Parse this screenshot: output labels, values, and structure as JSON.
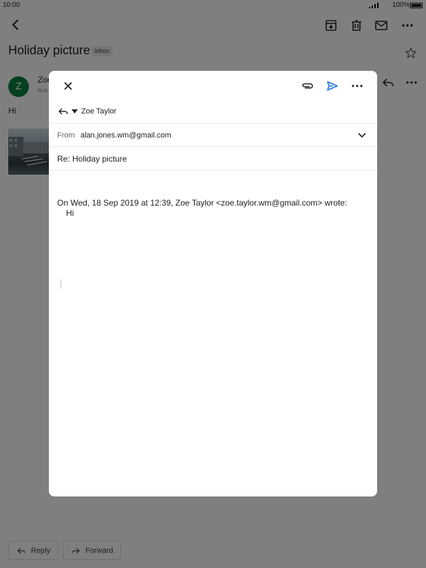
{
  "status_bar": {
    "time": "10:00",
    "battery": "100%"
  },
  "thread": {
    "subject": "Holiday picture",
    "label": "Inbox",
    "sender_initial": "Z",
    "sender_partial": "Zoe",
    "to_partial": "to n",
    "body": "Hi"
  },
  "bottom_actions": {
    "reply": "Reply",
    "forward": "Forward"
  },
  "compose": {
    "reply_to": "Zoe Taylor",
    "from_label": "From",
    "from_value": "alan.jones.wm@gmail.com",
    "subject": "Re: Holiday picture",
    "quote_header": "On Wed, 18 Sep 2019 at 12:39, Zoe Taylor <zoe.taylor.wm@gmail.com> wrote:",
    "quote_body": "Hi"
  },
  "colors": {
    "send_accent": "#1a73e8",
    "avatar": "#0b8043"
  },
  "icons": [
    "back-icon",
    "archive-icon",
    "delete-icon",
    "mail-icon",
    "more-icon",
    "star-icon",
    "reply-icon",
    "close-icon",
    "attach-icon",
    "send-icon",
    "chevron-down-icon",
    "forward-icon"
  ]
}
